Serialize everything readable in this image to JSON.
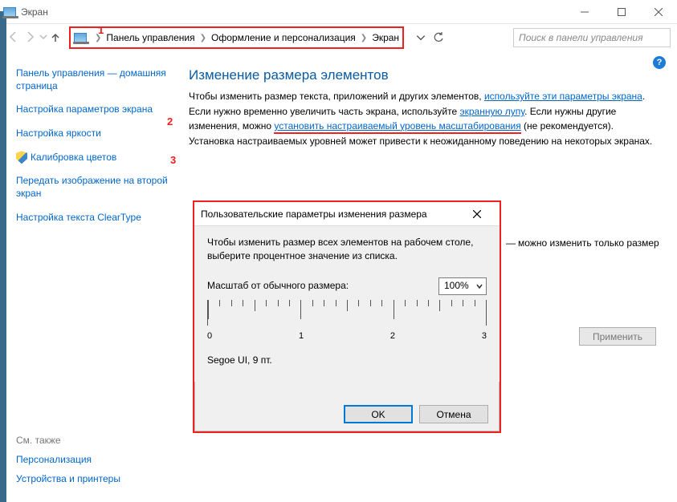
{
  "window": {
    "title": "Экран",
    "search_placeholder": "Поиск в панели управления"
  },
  "breadcrumb": {
    "items": [
      "Панель управления",
      "Оформление и персонализация",
      "Экран"
    ]
  },
  "sidebar": {
    "home": "Панель управления — домашняя страница",
    "items": [
      "Настройка параметров экрана",
      "Настройка яркости",
      "Калибровка цветов",
      "Передать изображение на второй экран",
      "Настройка текста ClearType"
    ]
  },
  "see_also": {
    "header": "См. также",
    "items": [
      "Персонализация",
      "Устройства и принтеры"
    ]
  },
  "content": {
    "heading": "Изменение размера элементов",
    "p1_a": "Чтобы изменить размер текста, приложений и других элементов, ",
    "p1_link": "используйте эти параметры экрана",
    "p1_b": ".",
    "p2_a": "Если нужно временно увеличить часть экрана, используйте ",
    "p2_link": "экранную лупу",
    "p2_b": ". Если нужны другие изменения, можно ",
    "p2_link2": "установить настраиваемый уровень масштабирования",
    "p2_c": " (не рекомендуется).",
    "p3": "Установка настраиваемых уровней может привести к неожиданному поведению на некоторых экранах.",
    "size_note": "можно изменить только размер",
    "apply": "Применить"
  },
  "annotations": {
    "a1": "1",
    "a2": "2",
    "a3": "3"
  },
  "dialog": {
    "title": "Пользовательские параметры изменения размера",
    "instr": "Чтобы изменить размер всех элементов на рабочем столе, выберите процентное значение из списка.",
    "scale_label": "Масштаб от обычного размера:",
    "scale_value": "100%",
    "ruler_labels": [
      "0",
      "1",
      "2",
      "3"
    ],
    "font_sample": "Segoe UI, 9 пт.",
    "ok": "OK",
    "cancel": "Отмена"
  }
}
